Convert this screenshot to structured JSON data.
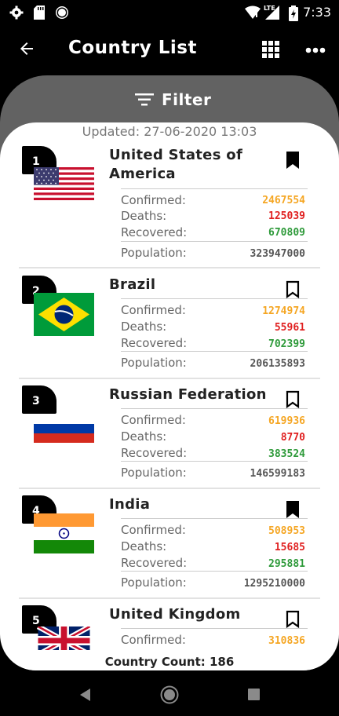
{
  "status": {
    "time": "7:33",
    "network": "LTE"
  },
  "appbar": {
    "title": "Country List"
  },
  "filter": {
    "label": "Filter"
  },
  "updated": "Updated: 27-06-2020 13:03",
  "labels": {
    "confirmed": "Confirmed:",
    "deaths": "Deaths:",
    "recovered": "Recovered:",
    "population": "Population:"
  },
  "countries": [
    {
      "rank": "1",
      "name": "United States of America",
      "confirmed": "2467554",
      "deaths": "125039",
      "recovered": "670809",
      "population": "323947000",
      "bookmarked": true
    },
    {
      "rank": "2",
      "name": "Brazil",
      "confirmed": "1274974",
      "deaths": "55961",
      "recovered": "702399",
      "population": "206135893",
      "bookmarked": false
    },
    {
      "rank": "3",
      "name": "Russian Federation",
      "confirmed": "619936",
      "deaths": "8770",
      "recovered": "383524",
      "population": "146599183",
      "bookmarked": false
    },
    {
      "rank": "4",
      "name": "India",
      "confirmed": "508953",
      "deaths": "15685",
      "recovered": "295881",
      "population": "1295210000",
      "bookmarked": true
    },
    {
      "rank": "5",
      "name": "United Kingdom",
      "confirmed": "310836",
      "deaths": "",
      "recovered": "",
      "population": "",
      "bookmarked": false
    }
  ],
  "footer": {
    "count": "Country Count: 186"
  },
  "colors": {
    "confirmed": "#f5a623",
    "deaths": "#e02020",
    "recovered": "#2e9a3a"
  }
}
